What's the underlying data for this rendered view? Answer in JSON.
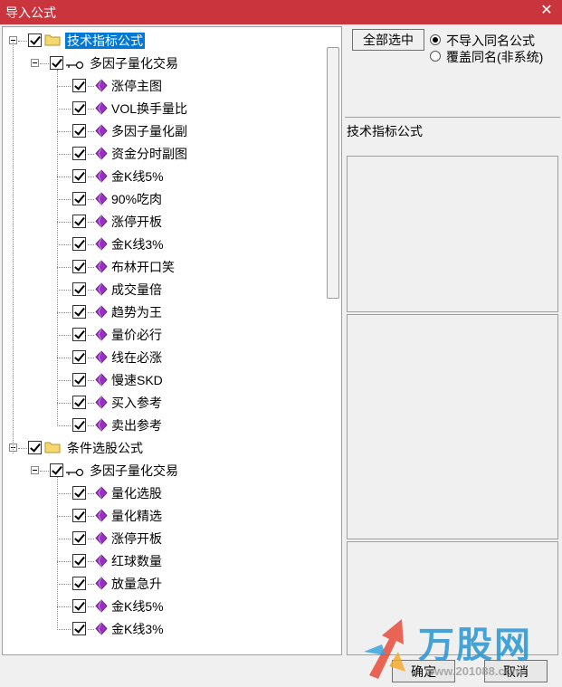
{
  "window": {
    "title": "导入公式",
    "close_glyph": "✕"
  },
  "tree": {
    "groups": [
      {
        "label": "技术指标公式",
        "selected": true,
        "child": {
          "label": "多因子量化交易",
          "items": [
            "涨停主图",
            "VOL换手量比",
            "多因子量化副",
            "资金分时副图",
            "金K线5%",
            "90%吃肉",
            "涨停开板",
            "金K线3%",
            "布林开口笑",
            "成交量倍",
            "趋势为王",
            "量价必行",
            "线在必涨",
            "慢速SKD",
            "买入参考",
            "卖出参考"
          ]
        }
      },
      {
        "label": "条件选股公式",
        "selected": false,
        "child": {
          "label": "多因子量化交易",
          "items": [
            "量化选股",
            "量化精选",
            "涨停开板",
            "红球数量",
            "放量急升",
            "金K线5%",
            "金K线3%"
          ]
        }
      }
    ]
  },
  "right": {
    "select_all_label": "全部选中",
    "options": [
      {
        "label": "不导入同名公式",
        "selected": true
      },
      {
        "label": "覆盖同名(非系统)",
        "selected": false
      }
    ],
    "section_label": "技术指标公式"
  },
  "footer": {
    "ok_label": "确定",
    "cancel_label": "取消"
  },
  "watermark": {
    "text": "万股网",
    "url": "www.201088.com"
  },
  "colors": {
    "titlebar": "#c9343d",
    "selection": "#0078d7",
    "gem": "#9b2fc4",
    "folder": "#f5d76e"
  }
}
